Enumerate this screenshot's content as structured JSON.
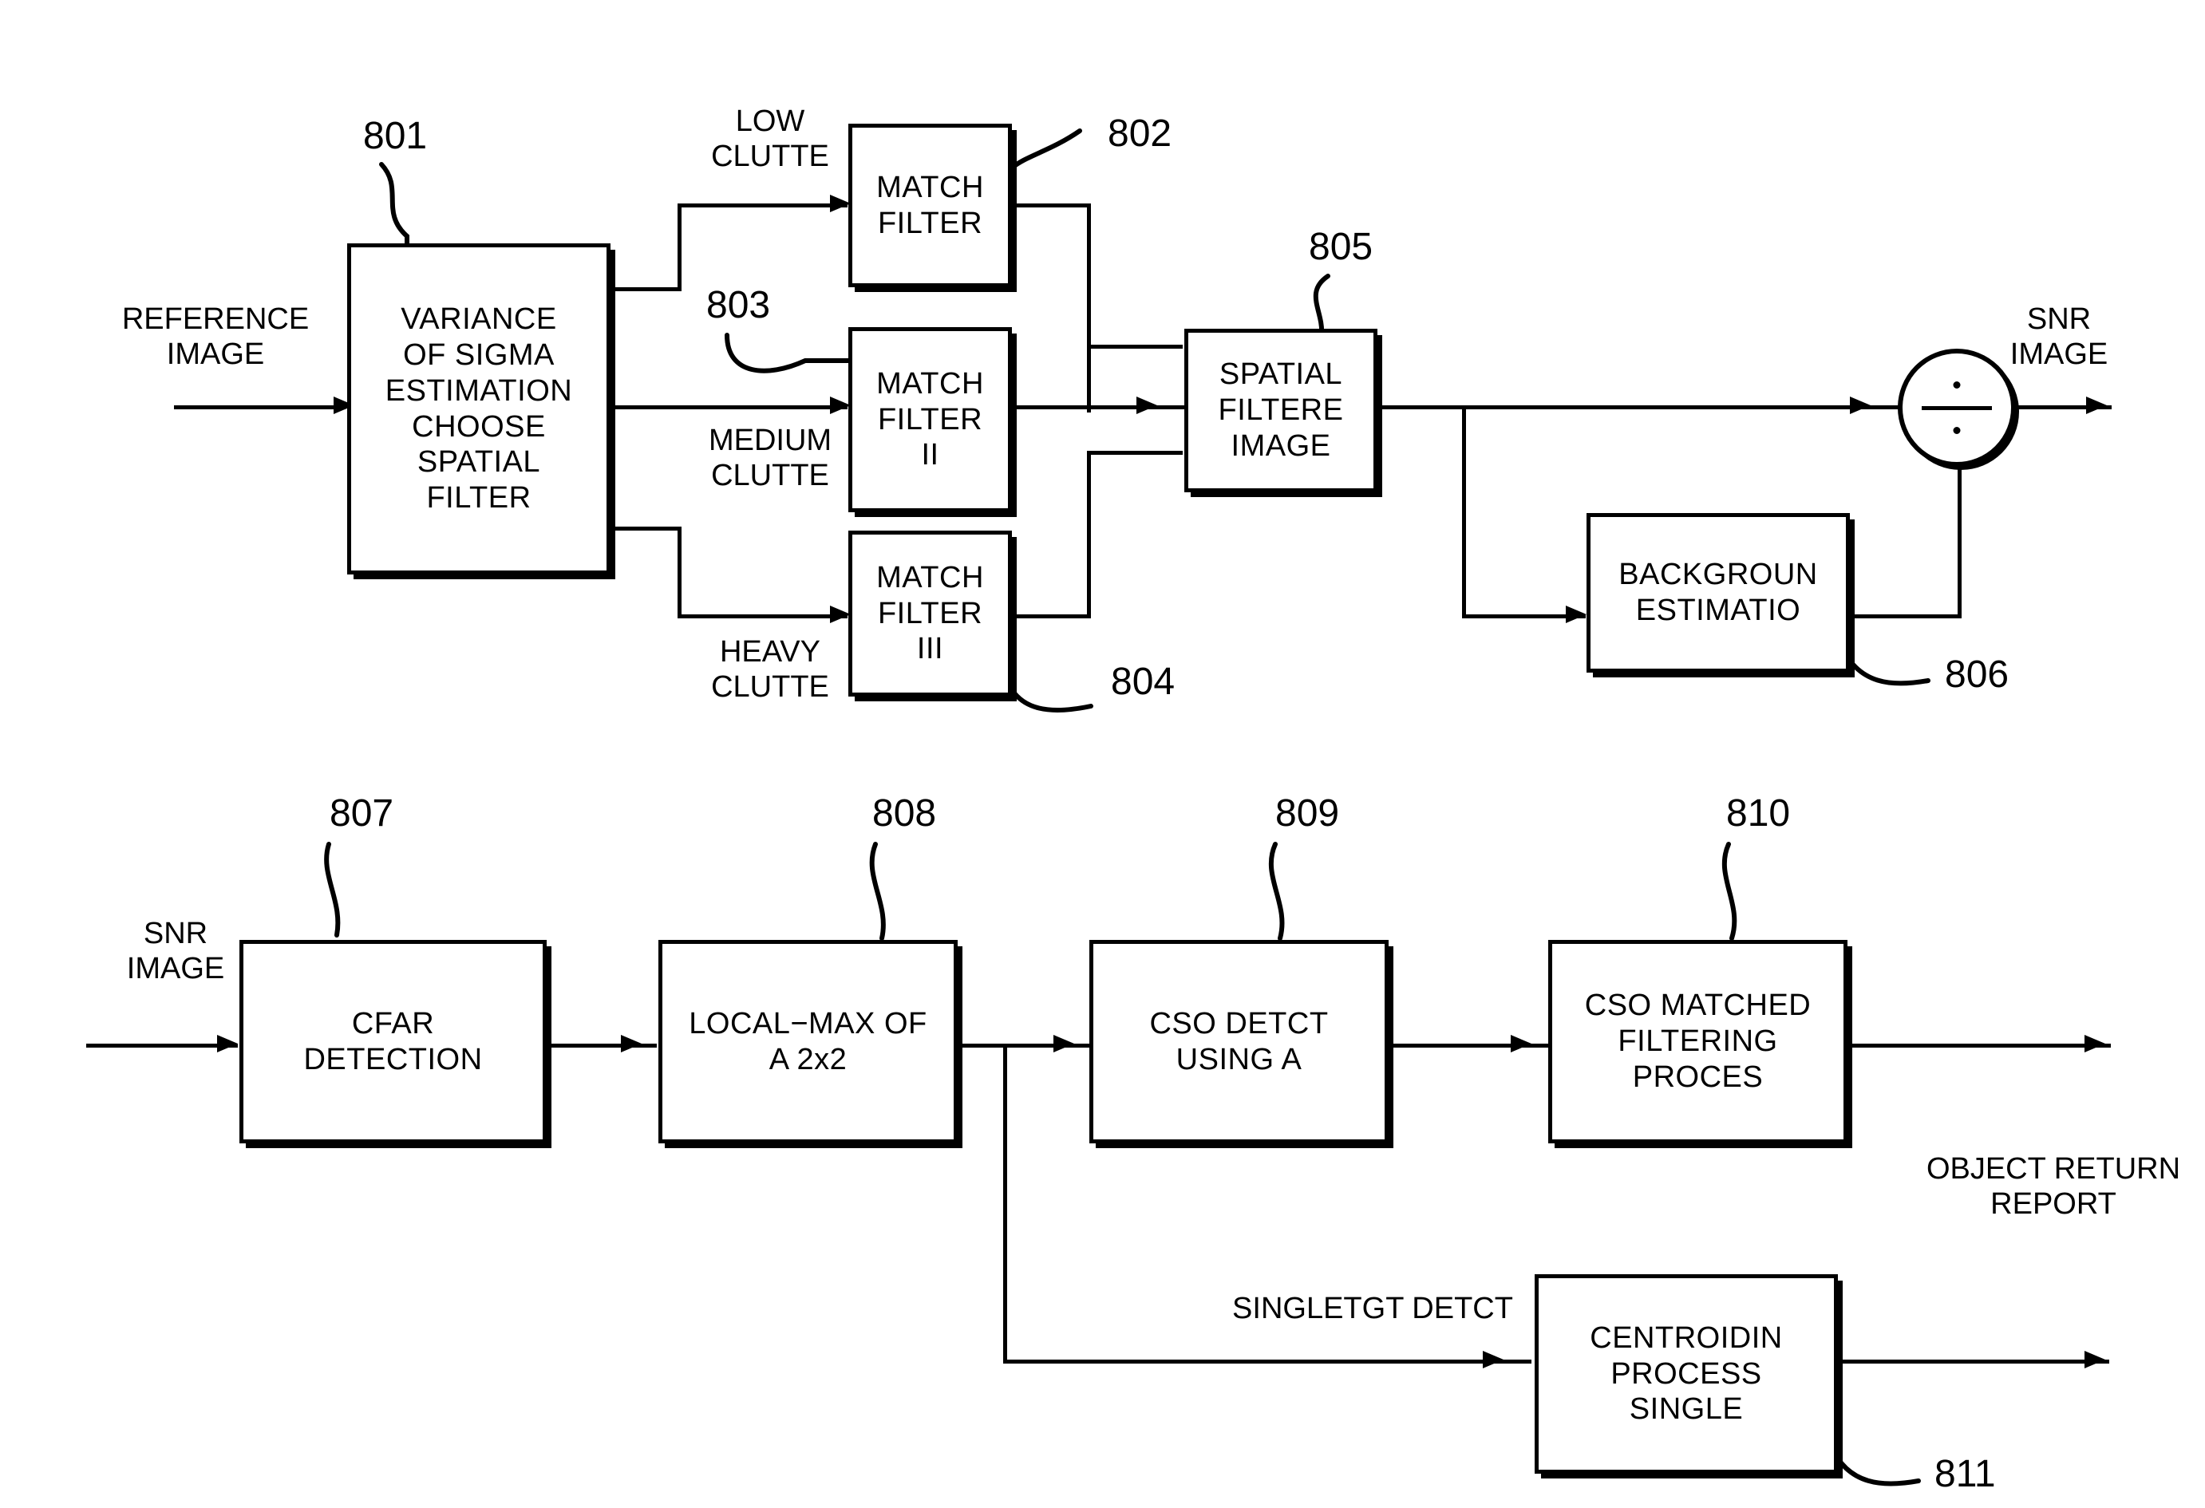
{
  "diagram": {
    "title": "Spatial filtering and CSO detection signal processing block diagram",
    "ink_color": "#000000",
    "background_color": "#ffffff"
  },
  "top_row": {
    "input_label": {
      "line1": "REFERENCE",
      "line2": "IMAGE"
    },
    "output_label": {
      "line1": "SNR",
      "line2": "IMAGE"
    },
    "blocks": [
      {
        "id": "801",
        "name": "variance-sigma-estimation",
        "lines": [
          "VARIANCE",
          "OF SIGMA",
          "ESTIMATION",
          "CHOOSE",
          "SPATIAL",
          "FILTER"
        ]
      },
      {
        "id": "802",
        "name": "match-filter-1",
        "lines": [
          "MATCH",
          "FILTER"
        ]
      },
      {
        "id": "803",
        "name": "match-filter-2",
        "lines": [
          "MATCH",
          "FILTER",
          "II"
        ]
      },
      {
        "id": "804",
        "name": "match-filter-3",
        "lines": [
          "MATCH",
          "FILTER",
          "III"
        ]
      },
      {
        "id": "805",
        "name": "spatial-filtered-image",
        "lines": [
          "SPATIAL",
          "FILTERE",
          "IMAGE"
        ]
      },
      {
        "id": "806",
        "name": "background-estimation",
        "lines": [
          "BACKGROUN",
          "ESTIMATIO"
        ]
      }
    ],
    "branch_labels": [
      {
        "name": "low-clutter",
        "line1": "LOW",
        "line2": "CLUTTE"
      },
      {
        "name": "medium-clutter",
        "line1": "MEDIUM",
        "line2": "CLUTTE"
      },
      {
        "name": "heavy-clutter",
        "line1": "HEAVY",
        "line2": "CLUTTE"
      }
    ],
    "divide_node": {
      "name": "divide-operator",
      "symbol": "division"
    }
  },
  "bottom_row": {
    "input_label": {
      "line1": "SNR",
      "line2": "IMAGE"
    },
    "output_label": {
      "line1": "OBJECT RETURN",
      "line2": "REPORT"
    },
    "branch_label": {
      "name": "single-target-detect",
      "text": "SINGLETGT DETCT"
    },
    "blocks": [
      {
        "id": "807",
        "name": "cfar-detection",
        "lines": [
          "CFAR",
          "DETECTION"
        ]
      },
      {
        "id": "808",
        "name": "local-max",
        "lines": [
          "LOCAL−MAX OF",
          "A 2x2"
        ]
      },
      {
        "id": "809",
        "name": "cso-detect",
        "lines": [
          "CSO DETCT",
          "USING A"
        ]
      },
      {
        "id": "810",
        "name": "cso-matched-filtering",
        "lines": [
          "CSO MATCHED",
          "FILTERING",
          "PROCES"
        ]
      },
      {
        "id": "811",
        "name": "centroiding-process-single",
        "lines": [
          "CENTROIDIN",
          "PROCESS",
          "SINGLE"
        ]
      }
    ]
  }
}
